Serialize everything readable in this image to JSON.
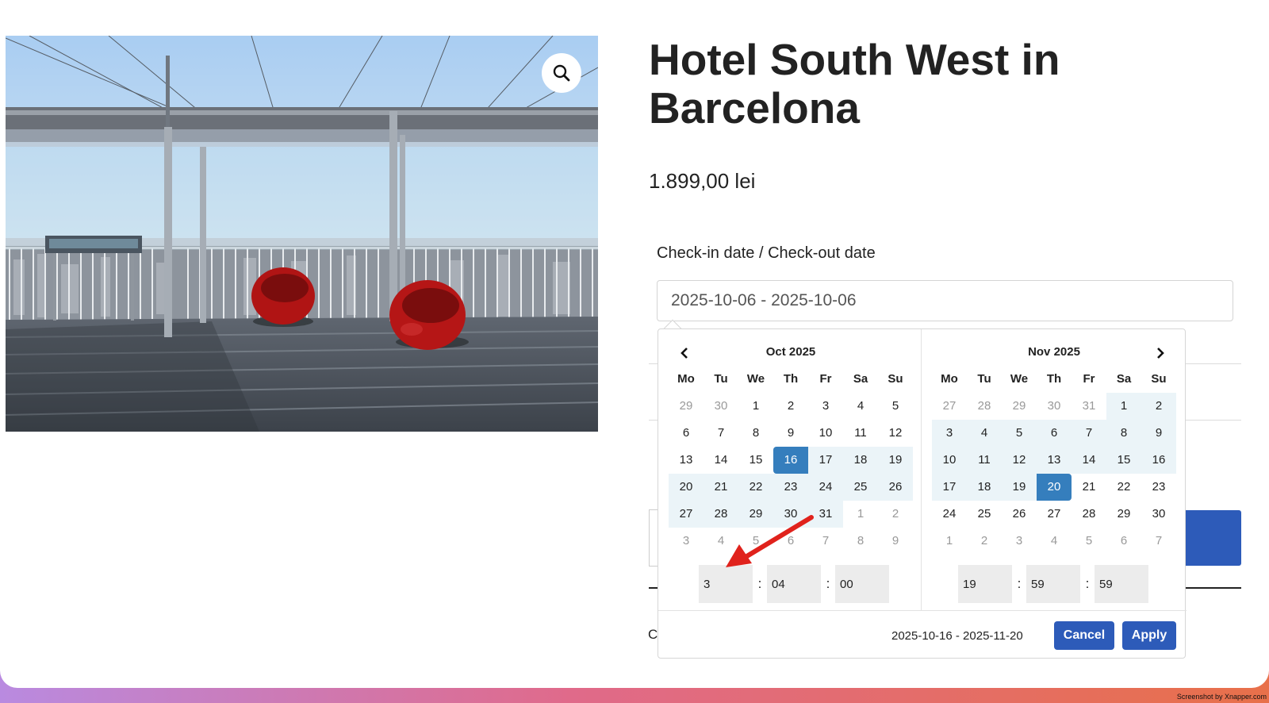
{
  "product": {
    "title": "Hotel South West in Barcelona",
    "price": "1.899,00 lei",
    "date_field_label": "Check-in date / Check-out date",
    "date_field_value": "2025-10-06 - 2025-10-06",
    "footer_fragment": "C"
  },
  "icons": {
    "zoom": "magnifier-icon",
    "prev": "chevron-left-icon",
    "next": "chevron-right-icon"
  },
  "picker": {
    "weekdays": [
      "Mo",
      "Tu",
      "We",
      "Th",
      "Fr",
      "Sa",
      "Su"
    ],
    "left": {
      "title": "Oct 2025",
      "weeks": [
        [
          {
            "d": "29",
            "s": "off"
          },
          {
            "d": "30",
            "s": "off"
          },
          {
            "d": "1",
            "s": ""
          },
          {
            "d": "2",
            "s": ""
          },
          {
            "d": "3",
            "s": ""
          },
          {
            "d": "4",
            "s": ""
          },
          {
            "d": "5",
            "s": ""
          }
        ],
        [
          {
            "d": "6",
            "s": ""
          },
          {
            "d": "7",
            "s": ""
          },
          {
            "d": "8",
            "s": ""
          },
          {
            "d": "9",
            "s": ""
          },
          {
            "d": "10",
            "s": ""
          },
          {
            "d": "11",
            "s": ""
          },
          {
            "d": "12",
            "s": ""
          }
        ],
        [
          {
            "d": "13",
            "s": ""
          },
          {
            "d": "14",
            "s": ""
          },
          {
            "d": "15",
            "s": ""
          },
          {
            "d": "16",
            "s": "sel sel-start"
          },
          {
            "d": "17",
            "s": "in"
          },
          {
            "d": "18",
            "s": "in"
          },
          {
            "d": "19",
            "s": "in"
          }
        ],
        [
          {
            "d": "20",
            "s": "in"
          },
          {
            "d": "21",
            "s": "in"
          },
          {
            "d": "22",
            "s": "in"
          },
          {
            "d": "23",
            "s": "in"
          },
          {
            "d": "24",
            "s": "in"
          },
          {
            "d": "25",
            "s": "in"
          },
          {
            "d": "26",
            "s": "in"
          }
        ],
        [
          {
            "d": "27",
            "s": "in"
          },
          {
            "d": "28",
            "s": "in"
          },
          {
            "d": "29",
            "s": "in"
          },
          {
            "d": "30",
            "s": "in"
          },
          {
            "d": "31",
            "s": "in"
          },
          {
            "d": "1",
            "s": "off"
          },
          {
            "d": "2",
            "s": "off"
          }
        ],
        [
          {
            "d": "3",
            "s": "off"
          },
          {
            "d": "4",
            "s": "off"
          },
          {
            "d": "5",
            "s": "off"
          },
          {
            "d": "6",
            "s": "off"
          },
          {
            "d": "7",
            "s": "off"
          },
          {
            "d": "8",
            "s": "off"
          },
          {
            "d": "9",
            "s": "off"
          }
        ]
      ],
      "time": {
        "hour": "3",
        "minute": "04",
        "second": "00"
      }
    },
    "right": {
      "title": "Nov 2025",
      "weeks": [
        [
          {
            "d": "27",
            "s": "off"
          },
          {
            "d": "28",
            "s": "off"
          },
          {
            "d": "29",
            "s": "off"
          },
          {
            "d": "30",
            "s": "off"
          },
          {
            "d": "31",
            "s": "off"
          },
          {
            "d": "1",
            "s": "in"
          },
          {
            "d": "2",
            "s": "in"
          }
        ],
        [
          {
            "d": "3",
            "s": "in"
          },
          {
            "d": "4",
            "s": "in"
          },
          {
            "d": "5",
            "s": "in"
          },
          {
            "d": "6",
            "s": "in"
          },
          {
            "d": "7",
            "s": "in"
          },
          {
            "d": "8",
            "s": "in"
          },
          {
            "d": "9",
            "s": "in"
          }
        ],
        [
          {
            "d": "10",
            "s": "in"
          },
          {
            "d": "11",
            "s": "in"
          },
          {
            "d": "12",
            "s": "in"
          },
          {
            "d": "13",
            "s": "in"
          },
          {
            "d": "14",
            "s": "in"
          },
          {
            "d": "15",
            "s": "in"
          },
          {
            "d": "16",
            "s": "in"
          }
        ],
        [
          {
            "d": "17",
            "s": "in"
          },
          {
            "d": "18",
            "s": "in"
          },
          {
            "d": "19",
            "s": "in"
          },
          {
            "d": "20",
            "s": "sel sel-end"
          },
          {
            "d": "21",
            "s": ""
          },
          {
            "d": "22",
            "s": ""
          },
          {
            "d": "23",
            "s": ""
          }
        ],
        [
          {
            "d": "24",
            "s": ""
          },
          {
            "d": "25",
            "s": ""
          },
          {
            "d": "26",
            "s": ""
          },
          {
            "d": "27",
            "s": ""
          },
          {
            "d": "28",
            "s": ""
          },
          {
            "d": "29",
            "s": ""
          },
          {
            "d": "30",
            "s": ""
          }
        ],
        [
          {
            "d": "1",
            "s": "off"
          },
          {
            "d": "2",
            "s": "off"
          },
          {
            "d": "3",
            "s": "off"
          },
          {
            "d": "4",
            "s": "off"
          },
          {
            "d": "5",
            "s": "off"
          },
          {
            "d": "6",
            "s": "off"
          },
          {
            "d": "7",
            "s": "off"
          }
        ]
      ],
      "time": {
        "hour": "19",
        "minute": "59",
        "second": "59"
      }
    },
    "time_separator": ":",
    "selected_range": "2025-10-16 - 2025-11-20",
    "cancel_label": "Cancel",
    "apply_label": "Apply"
  },
  "watermark": "Screenshot by Xnapper.com",
  "colors": {
    "accent": "#2d5bb9",
    "selected_day": "#357ebd",
    "in_range": "#ebf4f8",
    "annotation_arrow": "#e0221c"
  }
}
